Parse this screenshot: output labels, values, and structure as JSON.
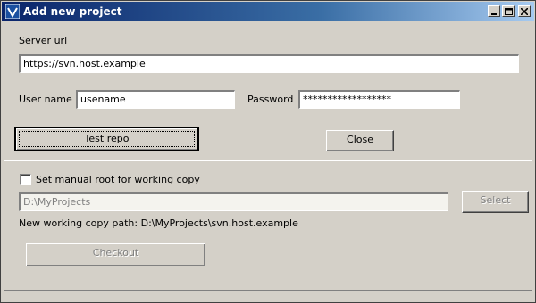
{
  "window": {
    "title": "Add new project",
    "icon": "app-logo-icon",
    "controls": [
      "minimize-icon",
      "maximize-icon",
      "close-icon"
    ]
  },
  "server": {
    "label": "Server url",
    "value": "https://svn.host.example"
  },
  "credentials": {
    "user_label": "User name",
    "user_value": "usename",
    "password_label": "Password",
    "password_value": "******************"
  },
  "buttons": {
    "test_repo": "Test repo",
    "close": "Close",
    "select": "Select",
    "checkout": "Checkout"
  },
  "working_copy": {
    "checkbox_label": "Set manual root for working copy",
    "checkbox_checked": false,
    "root_path": "D:\\MyProjects",
    "path_text": "New working copy path: D:\\MyProjects\\svn.host.example"
  },
  "colors": {
    "face": "#d4d0c8",
    "title_start": "#0a246a",
    "title_end": "#a6caf0",
    "disabled_text": "#808080"
  }
}
